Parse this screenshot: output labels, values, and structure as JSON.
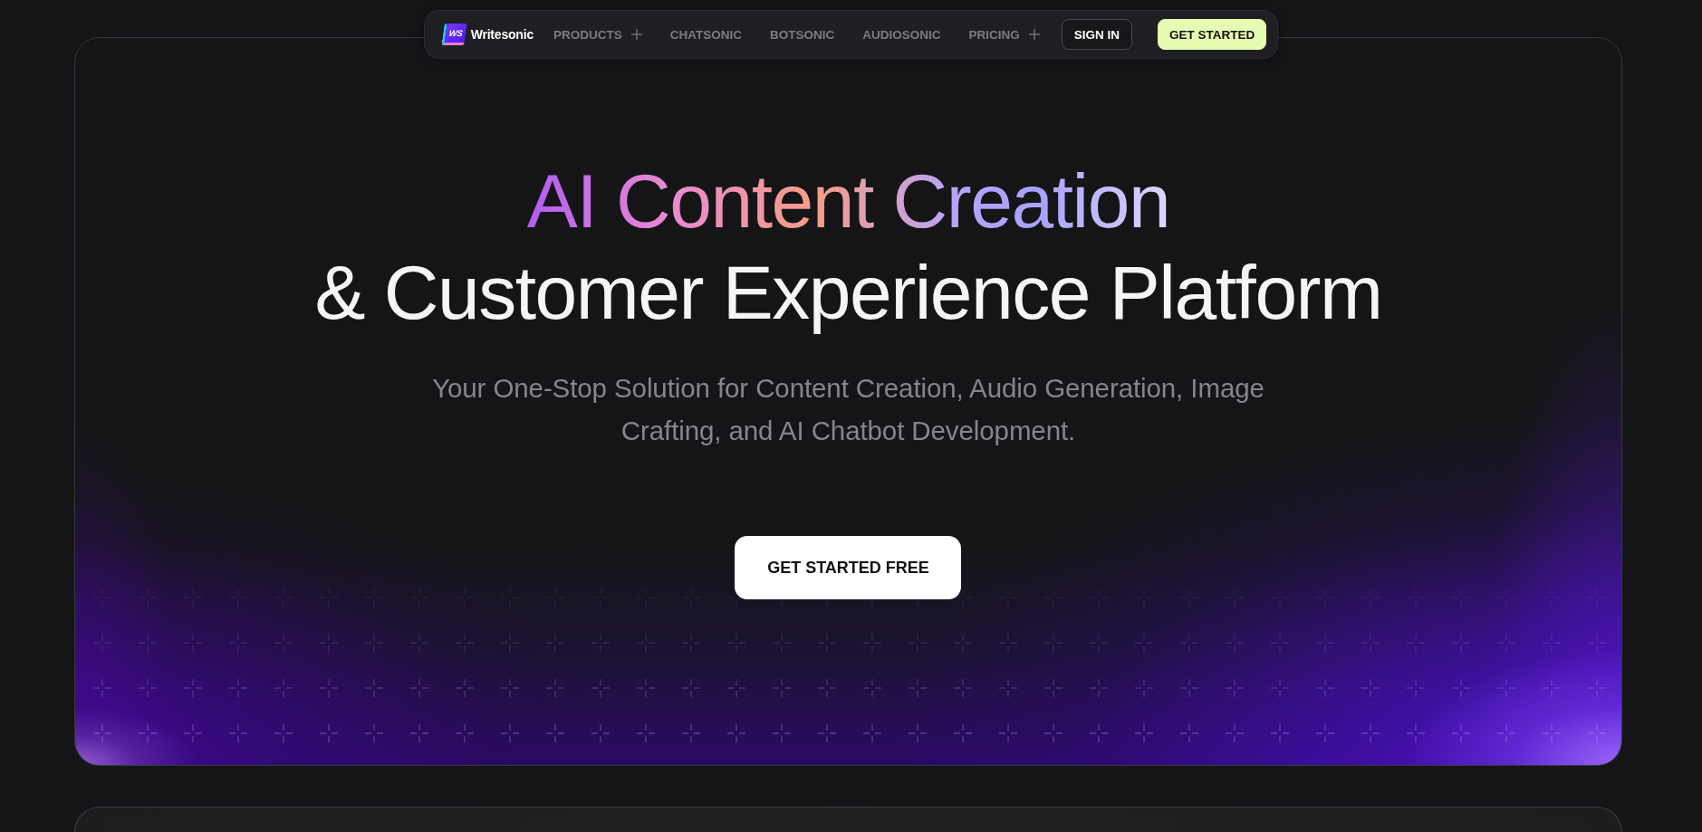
{
  "nav": {
    "logo": {
      "mark": "WS",
      "name": "Writesonic"
    },
    "items": [
      {
        "label": "PRODUCTS",
        "has_menu": true
      },
      {
        "label": "CHATSONIC",
        "has_menu": false
      },
      {
        "label": "BOTSONIC",
        "has_menu": false
      },
      {
        "label": "AUDIOSONIC",
        "has_menu": false
      },
      {
        "label": "PRICING",
        "has_menu": true
      }
    ],
    "buttons": [
      {
        "label": "SIGN IN",
        "kind": "outline"
      },
      {
        "label": "GET STARTED",
        "kind": "primary"
      }
    ]
  },
  "hero": {
    "heading": [
      {
        "text": "AI Content Creation",
        "kind": "gradient"
      },
      {
        "text": "& Customer Experience Platform",
        "kind": "plain"
      }
    ],
    "subtitle": "Your One-Stop Solution for Content Creation, Audio Generation, Image Crafting, and AI Chatbot Development.",
    "cta": "GET STARTED FREE"
  }
}
